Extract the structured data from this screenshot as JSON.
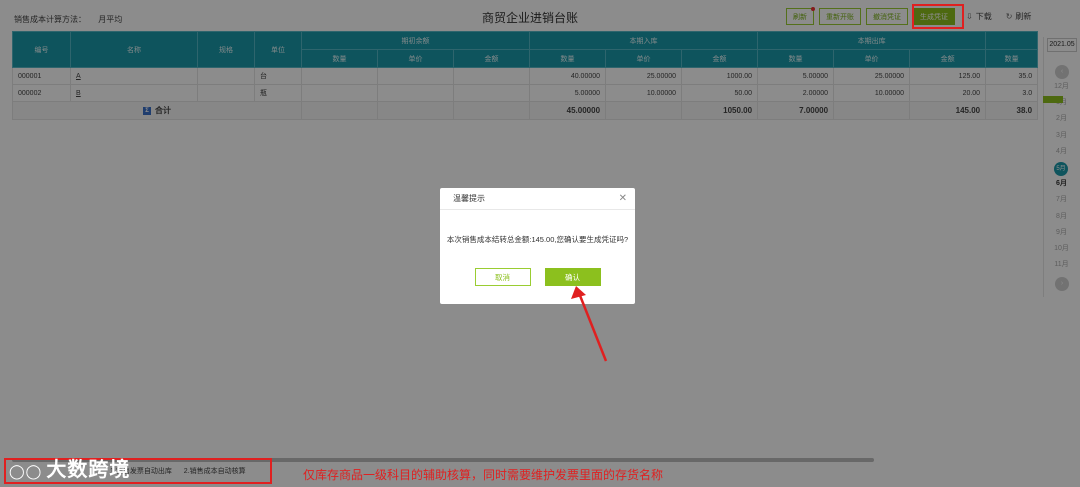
{
  "header": {
    "method_label": "销售成本计算方法：",
    "method_value": "月平均",
    "title": "商贸企业进销台账"
  },
  "toolbar": {
    "btn1": "刷新",
    "btn2": "重新开账",
    "btn3": "撤消凭证",
    "generate": "生成凭证",
    "download": "下载",
    "refresh": "刷新"
  },
  "table": {
    "headers": {
      "code": "编号",
      "name": "名称",
      "spec": "规格",
      "unit": "单位",
      "opening": "期初余额",
      "inbound": "本期入库",
      "outbound": "本期出库",
      "qty": "数量",
      "price": "单价",
      "amount": "金额"
    },
    "rows": [
      {
        "code": "000001",
        "name": "A",
        "spec": "",
        "unit": "台",
        "open_qty": "",
        "open_price": "",
        "open_amount": "",
        "in_qty": "40.00000",
        "in_price": "25.00000",
        "in_amount": "1000.00",
        "out_qty": "5.00000",
        "out_price": "25.00000",
        "out_amount": "125.00",
        "end_qty": "35.0"
      },
      {
        "code": "000002",
        "name": "B",
        "spec": "",
        "unit": "瓶",
        "open_qty": "",
        "open_price": "",
        "open_amount": "",
        "in_qty": "5.00000",
        "in_price": "10.00000",
        "in_amount": "50.00",
        "out_qty": "2.00000",
        "out_price": "10.00000",
        "out_amount": "20.00",
        "end_qty": "3.0"
      }
    ],
    "total": {
      "label": "合计",
      "in_qty": "45.00000",
      "in_amount": "1050.00",
      "out_qty": "7.00000",
      "out_amount": "145.00",
      "end_qty": "38.0"
    }
  },
  "months": {
    "year": "2021.05",
    "items": [
      "12月",
      "1月",
      "2月",
      "3月",
      "4月",
      "5月",
      "6月",
      "7月",
      "8月",
      "9月",
      "10月",
      "11月"
    ],
    "active": "5月"
  },
  "modal": {
    "title": "温馨提示",
    "message": "本次销售成本结转总金额:145.00,您确认要生成凭证吗?",
    "cancel": "取消",
    "confirm": "确认"
  },
  "footer": {
    "item1": "1.销售发票自动出库",
    "item2": "2.销售成本自动核算"
  },
  "annotation": "仅库存商品一级科目的辅助核算，同时需要维护发票里面的存货名称",
  "logo": "大数跨境",
  "colors": {
    "accent": "#8cc01e",
    "header_teal": "#1b9aaa",
    "annotation_red": "#e02020"
  }
}
